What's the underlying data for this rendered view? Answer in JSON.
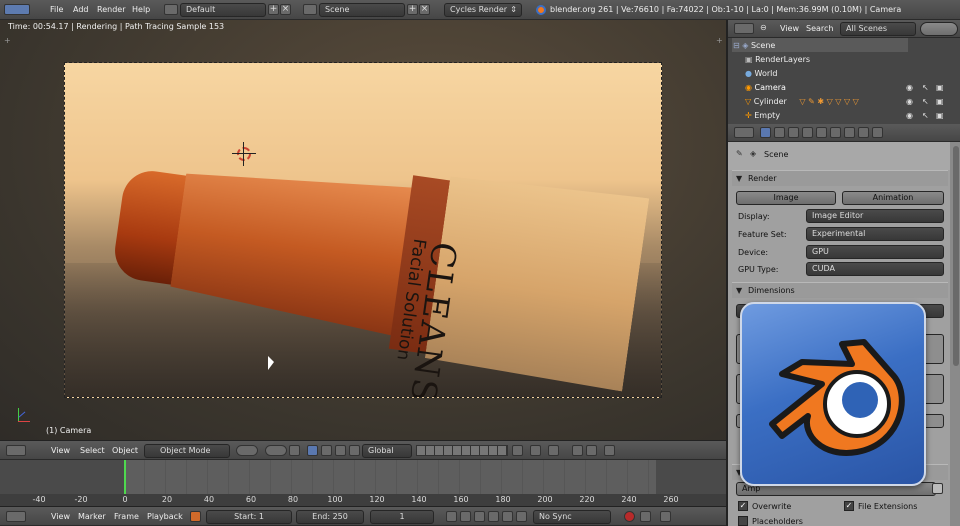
{
  "top_bar": {
    "menu": [
      "File",
      "Add",
      "Render",
      "Help"
    ],
    "layout": "Default",
    "scene": "Scene",
    "engine": "Cycles Render",
    "stats": "blender.org 261 | Ve:76610 | Fa:74022 | Ob:1-10 | La:0 | Mem:36.99M (0.10M) | Camera"
  },
  "viewport": {
    "status": "Time: 00:54.17 | Rendering | Path Tracing Sample 153",
    "product_brand": "CLEANSE",
    "product_sub": "Facial Solution",
    "object_label": "(1) Camera",
    "header": {
      "menus": [
        "View",
        "Select",
        "Object"
      ],
      "mode": "Object Mode",
      "orientation": "Global"
    }
  },
  "outliner": {
    "header": {
      "view": "View",
      "search": "Search",
      "filter": "All Scenes"
    },
    "items": [
      "Scene",
      "RenderLayers",
      "World",
      "Camera",
      "Cylinder",
      "Empty"
    ]
  },
  "properties": {
    "context": "Scene",
    "render_section": "Render",
    "image_button": "Image",
    "animation_button": "Animation",
    "rows": [
      {
        "label": "Display:",
        "value": "Image Editor"
      },
      {
        "label": "Feature Set:",
        "value": "Experimental"
      },
      {
        "label": "Device:",
        "value": "GPU"
      },
      {
        "label": "GPU Type:",
        "value": "CUDA"
      }
    ],
    "dimensions_section": "Dimensions",
    "overwrite": "Overwrite",
    "file_extensions": "File Extensions",
    "placeholders": "Placeholders",
    "output_path_stub": "Amp"
  },
  "timeline": {
    "ticks": [
      "-40",
      "-20",
      "0",
      "20",
      "40",
      "60",
      "80",
      "100",
      "120",
      "140",
      "160",
      "180",
      "200",
      "220",
      "240",
      "260"
    ],
    "menus": [
      "View",
      "Marker",
      "Frame",
      "Playback"
    ],
    "start": "Start: 1",
    "end": "End: 250",
    "current": "1",
    "sync": "No Sync"
  },
  "colors": {
    "accent": "#f07820",
    "logo_bg": "#3b6fc4",
    "playhead": "#4fd84f"
  }
}
